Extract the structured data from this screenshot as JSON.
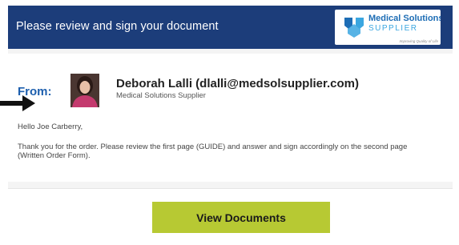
{
  "header": {
    "title": "Please review and sign your document",
    "background": "#1c3d7a"
  },
  "logo": {
    "name": "Medical Solutions",
    "sub": "SUPPLIER",
    "tagline": "Improving Quality of Life"
  },
  "email": {
    "from_label": "From:",
    "sender_name": "Deborah Lalli (dlalli@medsolsupplier.com)",
    "sender_company": "Medical Solutions Supplier",
    "greeting": "Hello Joe Carberry,",
    "message": "Thank you for the order.  Please review the first page (GUIDE) and answer and sign accordingly on the second page (Written Order Form)."
  },
  "action": {
    "button_label": "View Documents",
    "button_color": "#b7c933"
  },
  "icons": {
    "avatar": "avatar-photo",
    "pointer": "arrow-right-icon",
    "logo_mark": "medical-solutions-logo-icon"
  }
}
